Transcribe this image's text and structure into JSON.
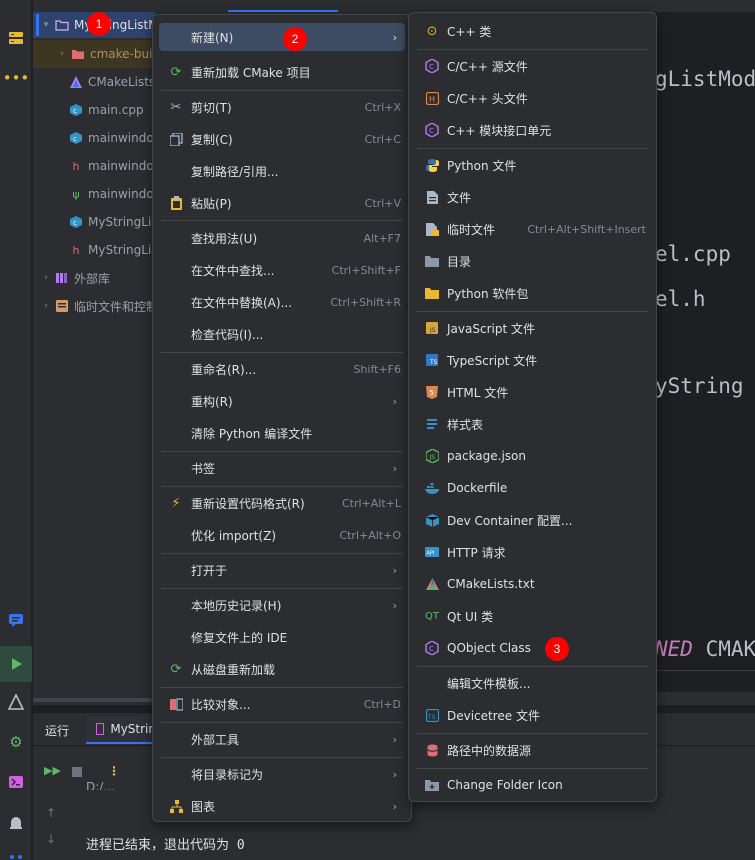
{
  "project_tree": {
    "rows": [
      {
        "label": "MyStringListM",
        "color": "#dfe1e5"
      },
      {
        "label": "cmake-buil",
        "color": "#b09060"
      },
      {
        "label": "CMakeLists",
        "color": "#9da0a8"
      },
      {
        "label": "main.cpp",
        "color": "#9da0a8"
      },
      {
        "label": "mainwindo",
        "color": "#9da0a8"
      },
      {
        "label": "mainwindo",
        "color": "#9da0a8"
      },
      {
        "label": "mainwindo",
        "color": "#9da0a8"
      },
      {
        "label": "MyStringLi",
        "color": "#9da0a8"
      },
      {
        "label": "MyStringLi",
        "color": "#9da0a8"
      },
      {
        "label": "外部库",
        "color": "#9da0a8"
      },
      {
        "label": "临时文件和控制",
        "color": "#9da0a8"
      }
    ]
  },
  "editor": {
    "lines": [
      "gListMod",
      "el.cpp",
      "el.h",
      "yString",
      "NED CMAK"
    ]
  },
  "run_panel": {
    "tab_run": "运行",
    "tab_config": "MyStrin",
    "output_partial": "D:/...",
    "output_line": "进程已结束，退出代码为 0"
  },
  "context_menu": {
    "items": [
      {
        "label": "新建(N)",
        "shortcut": "",
        "submenu": true,
        "icon": "none"
      },
      {
        "label": "重新加载 CMake 项目",
        "shortcut": "",
        "submenu": false,
        "icon": "reload-icon"
      },
      {
        "label": "剪切(T)",
        "shortcut": "Ctrl+X",
        "submenu": false,
        "icon": "cut-icon"
      },
      {
        "label": "复制(C)",
        "shortcut": "Ctrl+C",
        "submenu": false,
        "icon": "copy-icon"
      },
      {
        "label": "复制路径/引用...",
        "shortcut": "",
        "submenu": false,
        "icon": "none"
      },
      {
        "label": "粘贴(P)",
        "shortcut": "Ctrl+V",
        "submenu": false,
        "icon": "paste-icon"
      },
      {
        "label": "查找用法(U)",
        "shortcut": "Alt+F7",
        "submenu": false,
        "icon": "none"
      },
      {
        "label": "在文件中查找...",
        "shortcut": "Ctrl+Shift+F",
        "submenu": false,
        "icon": "none"
      },
      {
        "label": "在文件中替换(A)...",
        "shortcut": "Ctrl+Shift+R",
        "submenu": false,
        "icon": "none"
      },
      {
        "label": "检查代码(I)...",
        "shortcut": "",
        "submenu": false,
        "icon": "none"
      },
      {
        "label": "重命名(R)...",
        "shortcut": "Shift+F6",
        "submenu": false,
        "icon": "none"
      },
      {
        "label": "重构(R)",
        "shortcut": "",
        "submenu": true,
        "icon": "none"
      },
      {
        "label": "清除 Python 编译文件",
        "shortcut": "",
        "submenu": false,
        "icon": "none"
      },
      {
        "label": "书签",
        "shortcut": "",
        "submenu": true,
        "icon": "none"
      },
      {
        "label": "重新设置代码格式(R)",
        "shortcut": "Ctrl+Alt+L",
        "submenu": false,
        "icon": "magic-wand-icon"
      },
      {
        "label": "优化 import(Z)",
        "shortcut": "Ctrl+Alt+O",
        "submenu": false,
        "icon": "none"
      },
      {
        "label": "打开于",
        "shortcut": "",
        "submenu": true,
        "icon": "none"
      },
      {
        "label": "本地历史记录(H)",
        "shortcut": "",
        "submenu": true,
        "icon": "none"
      },
      {
        "label": "修复文件上的 IDE",
        "shortcut": "",
        "submenu": false,
        "icon": "none"
      },
      {
        "label": "从磁盘重新加载",
        "shortcut": "",
        "submenu": false,
        "icon": "reload-icon"
      },
      {
        "label": "比较对象...",
        "shortcut": "Ctrl+D",
        "submenu": false,
        "icon": "compare-icon"
      },
      {
        "label": "外部工具",
        "shortcut": "",
        "submenu": true,
        "icon": "none"
      },
      {
        "label": "将目录标记为",
        "shortcut": "",
        "submenu": true,
        "icon": "none"
      },
      {
        "label": "图表",
        "shortcut": "",
        "submenu": true,
        "icon": "diagram-icon"
      }
    ]
  },
  "new_submenu": {
    "items": [
      {
        "label": "C++ 类",
        "shortcut": ""
      },
      {
        "label": "C/C++ 源文件",
        "shortcut": ""
      },
      {
        "label": "C/C++ 头文件",
        "shortcut": ""
      },
      {
        "label": "C++ 模块接口单元",
        "shortcut": ""
      },
      {
        "label": "Python 文件",
        "shortcut": ""
      },
      {
        "label": "文件",
        "shortcut": ""
      },
      {
        "label": "临时文件",
        "shortcut": "Ctrl+Alt+Shift+Insert"
      },
      {
        "label": "目录",
        "shortcut": ""
      },
      {
        "label": "Python 软件包",
        "shortcut": ""
      },
      {
        "label": "JavaScript 文件",
        "shortcut": ""
      },
      {
        "label": "TypeScript 文件",
        "shortcut": ""
      },
      {
        "label": "HTML 文件",
        "shortcut": ""
      },
      {
        "label": "样式表",
        "shortcut": ""
      },
      {
        "label": "package.json",
        "shortcut": ""
      },
      {
        "label": "Dockerfile",
        "shortcut": ""
      },
      {
        "label": "Dev Container 配置...",
        "shortcut": ""
      },
      {
        "label": "HTTP 请求",
        "shortcut": ""
      },
      {
        "label": "CMakeLists.txt",
        "shortcut": ""
      },
      {
        "label": "Qt UI 类",
        "shortcut": ""
      },
      {
        "label": "QObject Class",
        "shortcut": ""
      },
      {
        "label": "编辑文件模板...",
        "shortcut": ""
      },
      {
        "label": "Devicetree 文件",
        "shortcut": ""
      },
      {
        "label": "路径中的数据源",
        "shortcut": ""
      },
      {
        "label": "Change Folder Icon",
        "shortcut": ""
      }
    ]
  },
  "badges": [
    "1",
    "2",
    "3"
  ],
  "colors": {
    "selection": "#3d4c62",
    "badge": "#ff0000",
    "accent": "#3574f0"
  }
}
